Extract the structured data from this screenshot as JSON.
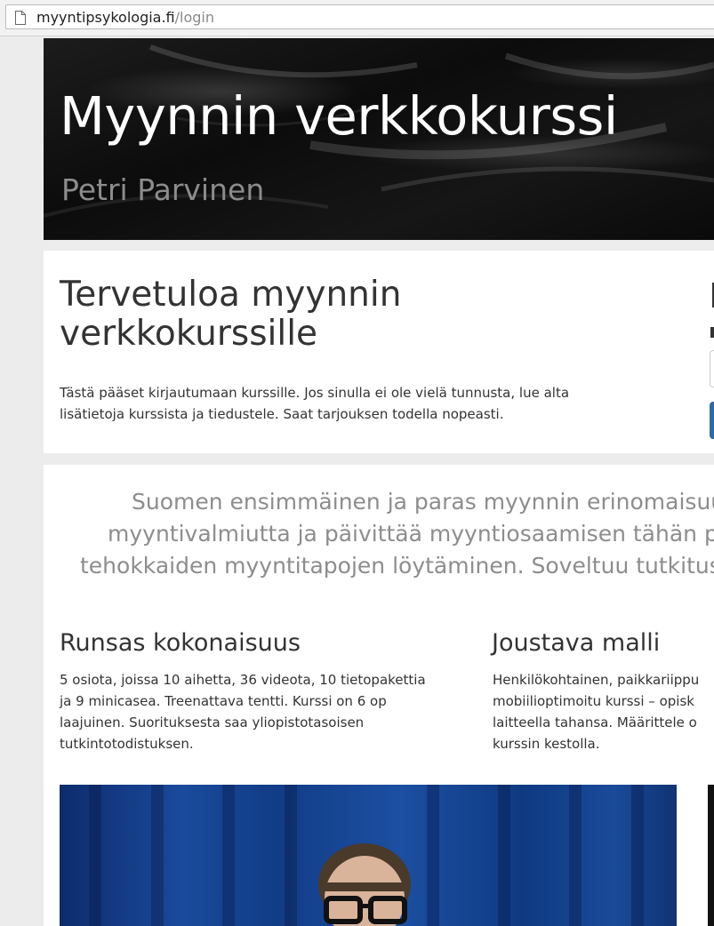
{
  "browser": {
    "url_host": "myyntipsykologia.fi",
    "url_path": "/login",
    "icons": {
      "page": "page-icon"
    }
  },
  "hero": {
    "title": "Myynnin verkkokurssi",
    "subtitle": "Petri Parvinen"
  },
  "welcome": {
    "title": "Tervetuloa myynnin verkkokurssille",
    "text": "Tästä pääset kirjautumaan kurssille. Jos sinulla ei ole vielä tunnusta, lue alta lisätietoja kurssista ja tiedustele. Saat tarjouksen todella nopeasti."
  },
  "info": {
    "lead_lines": [
      "Suomen ensimmäinen ja paras myynnin erinomaisuutee",
      "myyntivalmiutta ja päivittää myyntiosaamisen tähän päivää",
      "tehokkaiden myyntitapojen löytäminen. Soveltuu tutkitusti ka"
    ],
    "columns": [
      {
        "title": "Runsas kokonaisuus",
        "lines": [
          "5 osiota, joissa 10 aihetta, 36 videota, 10 tietopakettia",
          "ja 9 minicasea. Treenattava tentti. Kurssi on 6 op",
          "laajuinen. Suorituksesta saa yliopistotasoisen",
          "tutkintotodistuksen."
        ]
      },
      {
        "title": "Joustava malli",
        "lines": [
          "Henkilökohtainen, paikkariippu",
          "mobiilioptimoitu kurssi – opisk",
          "laitteella tahansa. Määrittele o",
          "kurssin kestolla."
        ]
      }
    ]
  }
}
